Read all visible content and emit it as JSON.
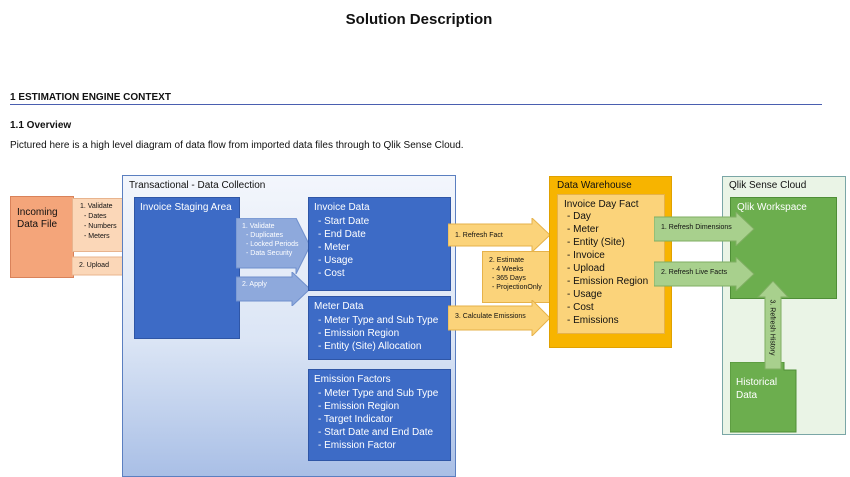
{
  "doc": {
    "title": "Solution Description",
    "section_heading": "1 ESTIMATION ENGINE CONTEXT",
    "subsection_heading": "1.1 Overview",
    "intro": "Pictured here is a high level diagram of data flow from imported data files through to Qlik Sense Cloud."
  },
  "diagram": {
    "incoming": {
      "line1": "Incoming",
      "line2": "Data File"
    },
    "validate_note": {
      "title": "1. Validate",
      "items": [
        "- Dates",
        "- Numbers",
        "- Meters"
      ]
    },
    "upload_label": "2. Upload",
    "transactional": {
      "label": "Transactional - Data Collection",
      "staging": "Invoice Staging Area",
      "validate_arrow": {
        "title": "1. Validate",
        "items": [
          "- Duplicates",
          "- Locked Periods",
          "- Data Security"
        ]
      },
      "apply_label": "2. Apply",
      "invoice_data": {
        "title": "Invoice Data",
        "items": [
          "- Start Date",
          "- End Date",
          "- Meter",
          "- Usage",
          "- Cost"
        ]
      },
      "meter_data": {
        "title": "Meter Data",
        "items": [
          "- Meter Type and Sub Type",
          "- Emission Region",
          "- Entity (Site) Allocation"
        ]
      },
      "emission_factors": {
        "title": "Emission Factors",
        "items": [
          "- Meter Type and Sub Type",
          "- Emission Region",
          "- Target Indicator",
          "- Start Date and End Date",
          "- Emission Factor"
        ]
      }
    },
    "refresh_fact_label": "1. Refresh Fact",
    "estimate": {
      "title": "2. Estimate",
      "items": [
        "- 4 Weeks",
        "- 365 Days",
        "- ProjectionOnly"
      ]
    },
    "calculate_label": "3. Calculate Emissions",
    "warehouse": {
      "label": "Data Warehouse",
      "fact_title": "Invoice Day Fact",
      "fact_items": [
        "- Day",
        "- Meter",
        "- Entity (Site)",
        "- Invoice",
        "- Upload",
        "- Emission Region",
        "- Usage",
        "- Cost",
        "- Emissions"
      ]
    },
    "refresh_dimensions_label": "1. Refresh Dimensions",
    "refresh_live_label": "2. Refresh Live Facts",
    "refresh_history_label": "3. Refresh History",
    "qlik": {
      "label": "Qlik Sense Cloud",
      "workspace": "Qlik Workspace",
      "historical_line1": "Historical",
      "historical_line2": "Data"
    },
    "colors": {
      "blue": "#3d6bc6",
      "light_blue": "#8ea9dc",
      "orange": "#f4a57a",
      "peach": "#fbd7b8",
      "gold": "#f7b400",
      "light_gold": "#fbd37a",
      "green": "#6cae4e",
      "light_green": "#a8d08d"
    }
  }
}
